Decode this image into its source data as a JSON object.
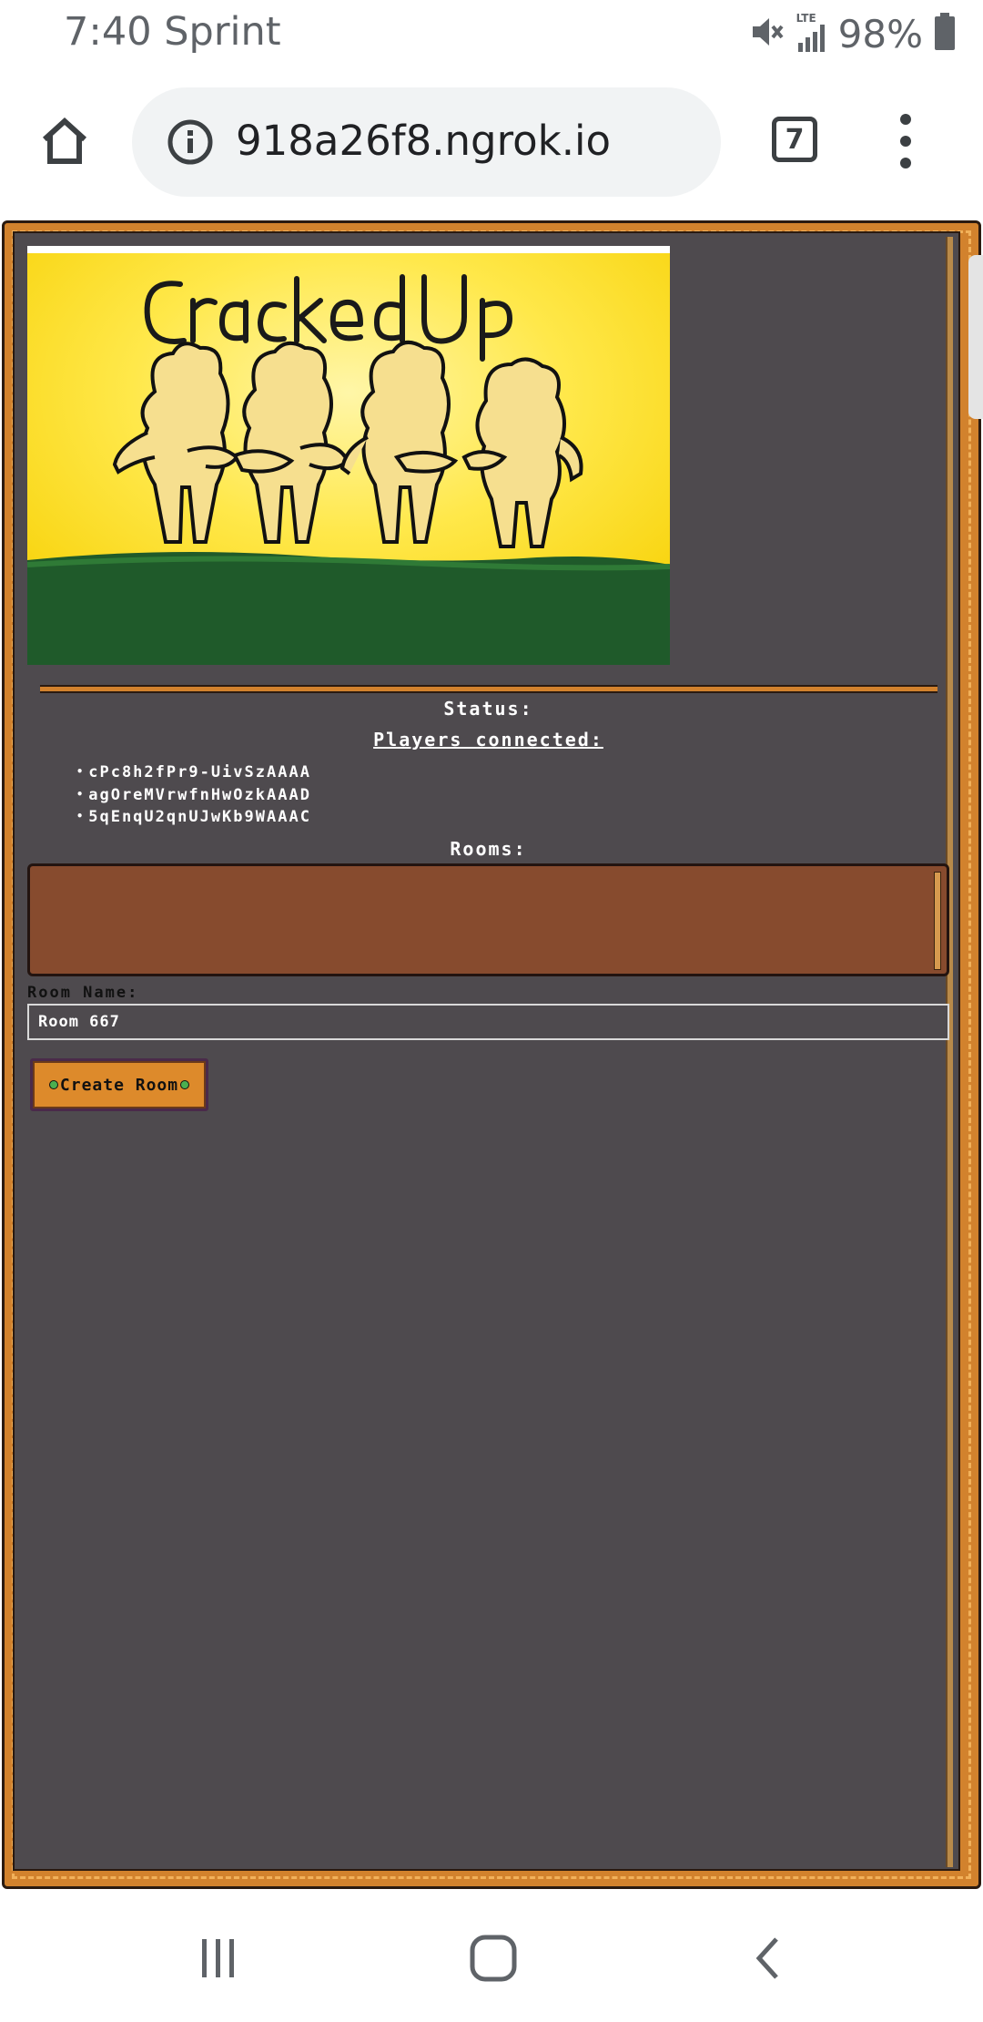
{
  "status_bar": {
    "time_carrier": "7:40 Sprint",
    "network_type": "LTE",
    "battery_percent": "98%",
    "icons": [
      "mute-icon",
      "signal-icon",
      "battery-icon"
    ]
  },
  "browser": {
    "url": "918a26f8.ngrok.io",
    "tab_count": "7",
    "icons": [
      "home-icon",
      "info-icon",
      "tabs-icon",
      "more-icon"
    ]
  },
  "game": {
    "banner_title": "Cracked Up",
    "status_label": "Status:",
    "players_label": "Players connected:",
    "players": [
      "cPc8h2fPr9-UivSzAAAA",
      "agOreMVrwfnHwOzkAAAD",
      "5qEnqU2qnUJwKb9WAAAC"
    ],
    "rooms_label": "Rooms:",
    "rooms": [],
    "room_name_label": "Room Name:",
    "room_name_value": "Room 667",
    "create_room_label": "Create Room"
  },
  "colors": {
    "frame_orange": "#d2822d",
    "panel_gray": "#4e4a4e",
    "rooms_box_brown": "#874b2e",
    "button_orange": "#dd8a2b"
  },
  "nav_bar": {
    "icons": [
      "recents-icon",
      "home-circle-icon",
      "back-icon"
    ]
  }
}
